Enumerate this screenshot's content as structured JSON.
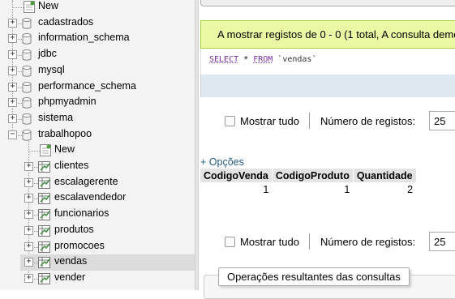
{
  "nav": {
    "items": [
      {
        "label": "New",
        "type": "new",
        "level": 0
      },
      {
        "label": "cadastrados",
        "type": "db",
        "level": 0,
        "expander": "+"
      },
      {
        "label": "information_schema",
        "type": "db",
        "level": 0,
        "expander": "+"
      },
      {
        "label": "jdbc",
        "type": "db",
        "level": 0,
        "expander": "+"
      },
      {
        "label": "mysql",
        "type": "db",
        "level": 0,
        "expander": "+"
      },
      {
        "label": "performance_schema",
        "type": "db",
        "level": 0,
        "expander": "+"
      },
      {
        "label": "phpmyadmin",
        "type": "db",
        "level": 0,
        "expander": "+"
      },
      {
        "label": "sistema",
        "type": "db",
        "level": 0,
        "expander": "+"
      },
      {
        "label": "trabalhopoo",
        "type": "db",
        "level": 0,
        "expander": "−"
      },
      {
        "label": "New",
        "type": "new",
        "level": 1
      },
      {
        "label": "clientes",
        "type": "table",
        "level": 1,
        "expander": "+"
      },
      {
        "label": "escalagerente",
        "type": "table",
        "level": 1,
        "expander": "+"
      },
      {
        "label": "escalavendedor",
        "type": "table",
        "level": 1,
        "expander": "+"
      },
      {
        "label": "funcionarios",
        "type": "table",
        "level": 1,
        "expander": "+"
      },
      {
        "label": "produtos",
        "type": "table",
        "level": 1,
        "expander": "+"
      },
      {
        "label": "promocoes",
        "type": "table",
        "level": 1,
        "expander": "+"
      },
      {
        "label": "vendas",
        "type": "table",
        "level": 1,
        "expander": "+",
        "selected": true
      },
      {
        "label": "vender",
        "type": "table",
        "level": 1,
        "expander": "+"
      }
    ]
  },
  "main": {
    "success_message": "A mostrar registos de 0 - 0 (1 total, A consulta demorou",
    "sql": {
      "keyword1": "SELECT",
      "rest1": " * ",
      "keyword2": "FROM",
      "table": " `vendas`"
    },
    "controls": {
      "show_all_label": "Mostrar tudo",
      "rows_label": "Número de registos:",
      "rows_value": "25"
    },
    "options_link": "+ Opções",
    "table": {
      "headers": [
        "CodigoVenda",
        "CodigoProduto",
        "Quantidade"
      ],
      "rows": [
        [
          "1",
          "1",
          "2"
        ]
      ]
    },
    "ops_legend": "Operações resultantes das consultas"
  },
  "colors": {
    "success_bg": "#ebf8a4",
    "success_border": "#a2d246",
    "link": "#235a81",
    "sql_keyword": "#7a2fa0"
  }
}
